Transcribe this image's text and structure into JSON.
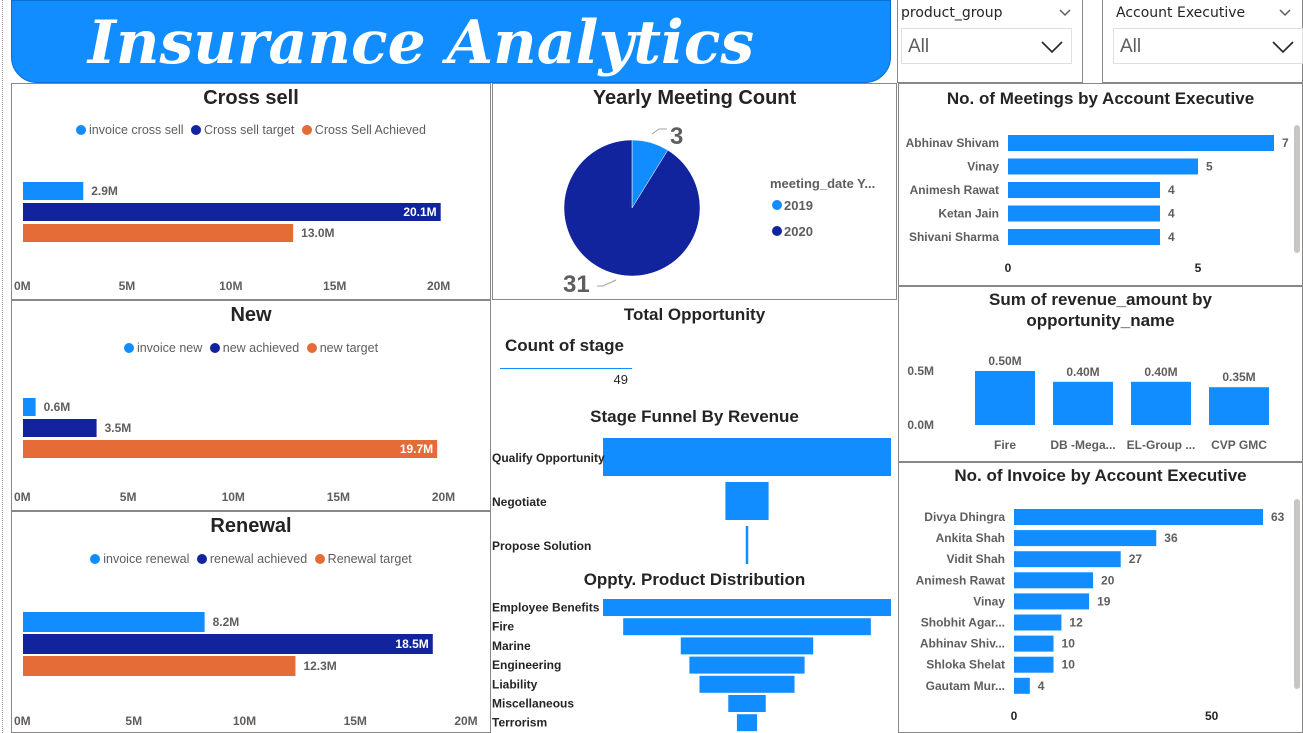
{
  "header": {
    "title": "Insurance Analytics"
  },
  "slicers": [
    {
      "label": "product_group",
      "value": "All"
    },
    {
      "label": "Account Executive",
      "value": "All"
    }
  ],
  "colors": {
    "light": "#118dff",
    "dark": "#12239e",
    "orange": "#e66c37",
    "brand": "#118dff"
  },
  "cross_sell": {
    "title": "Cross sell",
    "legend": [
      {
        "name": "invoice cross sell",
        "color": "#118dff"
      },
      {
        "name": "Cross sell target",
        "color": "#12239e"
      },
      {
        "name": "Cross Sell Achieved",
        "color": "#e66c37"
      }
    ]
  },
  "new": {
    "title": "New",
    "legend": [
      {
        "name": "invoice new",
        "color": "#118dff"
      },
      {
        "name": "new achieved",
        "color": "#12239e"
      },
      {
        "name": "new target",
        "color": "#e66c37"
      }
    ]
  },
  "renewal": {
    "title": "Renewal",
    "legend": [
      {
        "name": "invoice renewal",
        "color": "#118dff"
      },
      {
        "name": "renewal achieved",
        "color": "#12239e"
      },
      {
        "name": "Renewal target",
        "color": "#e66c37"
      }
    ]
  },
  "yearly": {
    "title": "Yearly Meeting Count",
    "legend_title": "meeting_date Y..."
  },
  "total_opp": {
    "title": "Total Opportunity",
    "card_label": "Count of stage",
    "card_value": "49"
  },
  "funnel_stage": {
    "title": "Stage Funnel By Revenue"
  },
  "funnel_product": {
    "title": "Oppty. Product Distribution"
  },
  "meetings": {
    "title": "No. of Meetings by Account Executive"
  },
  "revenue": {
    "title_line1": "Sum of revenue_amount by",
    "title_line2": "opportunity_name"
  },
  "invoice": {
    "title": "No. of Invoice by Account Executive"
  },
  "chart_data": [
    {
      "id": "cross_sell",
      "type": "bar",
      "orientation": "horizontal",
      "series": [
        {
          "name": "invoice cross sell",
          "value": 2.9,
          "label": "2.9M"
        },
        {
          "name": "Cross sell target",
          "value": 20.1,
          "label": "20.1M"
        },
        {
          "name": "Cross Sell Achieved",
          "value": 13.0,
          "label": "13.0M"
        }
      ],
      "xlim": [
        0,
        20.5
      ],
      "ticks": [
        0,
        5,
        10,
        15,
        20
      ],
      "tick_labels": [
        "0M",
        "5M",
        "10M",
        "15M",
        "20M"
      ]
    },
    {
      "id": "new",
      "type": "bar",
      "orientation": "horizontal",
      "series": [
        {
          "name": "invoice new",
          "value": 0.6,
          "label": "0.6M"
        },
        {
          "name": "new achieved",
          "value": 3.5,
          "label": "3.5M"
        },
        {
          "name": "new target",
          "value": 19.7,
          "label": "19.7M"
        }
      ],
      "xlim": [
        0,
        20.5
      ],
      "ticks": [
        0,
        5,
        10,
        15,
        20
      ],
      "tick_labels": [
        "0M",
        "5M",
        "10M",
        "15M",
        "20M"
      ]
    },
    {
      "id": "renewal",
      "type": "bar",
      "orientation": "horizontal",
      "series": [
        {
          "name": "invoice renewal",
          "value": 8.2,
          "label": "8.2M"
        },
        {
          "name": "renewal achieved",
          "value": 18.5,
          "label": "18.5M"
        },
        {
          "name": "Renewal target",
          "value": 12.3,
          "label": "12.3M"
        }
      ],
      "xlim": [
        0,
        20
      ],
      "ticks": [
        0,
        5,
        10,
        15,
        20
      ],
      "tick_labels": [
        "0M",
        "5M",
        "10M",
        "15M",
        "20M"
      ]
    },
    {
      "id": "yearly",
      "type": "pie",
      "slices": [
        {
          "name": "2019",
          "value": 3,
          "label": "3",
          "color": "#118dff"
        },
        {
          "name": "2020",
          "value": 31,
          "label": "31",
          "color": "#12239e"
        }
      ]
    },
    {
      "id": "meetings",
      "type": "bar",
      "orientation": "horizontal",
      "categories": [
        "Abhinav Shivam",
        "Vinay",
        "Animesh Rawat",
        "Ketan Jain",
        "Shivani Sharma"
      ],
      "values": [
        7,
        5,
        4,
        4,
        4
      ],
      "labels": [
        "7",
        "5",
        "4",
        "4",
        "4"
      ],
      "xlim": [
        0,
        7
      ],
      "ticks": [
        0,
        5
      ],
      "tick_labels": [
        "0",
        "5"
      ]
    },
    {
      "id": "revenue",
      "type": "bar",
      "orientation": "vertical",
      "categories": [
        "Fire",
        "DB -Mega...",
        "EL-Group ...",
        "CVP GMC"
      ],
      "values": [
        0.5,
        0.4,
        0.4,
        0.35
      ],
      "labels": [
        "0.50M",
        "0.40M",
        "0.40M",
        "0.35M"
      ],
      "ylim": [
        0,
        0.5
      ],
      "ticks": [
        0,
        0.5
      ],
      "tick_labels": [
        "0.0M",
        "0.5M"
      ]
    },
    {
      "id": "invoice",
      "type": "bar",
      "orientation": "horizontal",
      "categories": [
        "Divya Dhingra",
        "Ankita Shah",
        "Vidit Shah",
        "Animesh Rawat",
        "Vinay",
        "Shobhit Agar...",
        "Abhinav Shiv...",
        "Shloka Shelat",
        "Gautam Mur..."
      ],
      "values": [
        63,
        36,
        27,
        20,
        19,
        12,
        10,
        10,
        4
      ],
      "labels": [
        "63",
        "36",
        "27",
        "20",
        "19",
        "12",
        "10",
        "10",
        "4"
      ],
      "xlim": [
        0,
        63
      ],
      "ticks": [
        0,
        50
      ],
      "tick_labels": [
        "0",
        "50"
      ]
    },
    {
      "id": "funnel_stage",
      "type": "funnel",
      "categories": [
        "Qualify Opportunity",
        "Negotiate",
        "Propose Solution"
      ],
      "values": [
        100,
        15,
        0.8
      ]
    },
    {
      "id": "funnel_product",
      "type": "funnel",
      "categories": [
        "Employee Benefits",
        "Fire",
        "Marine",
        "Engineering",
        "Liability",
        "Miscellaneous",
        "Terrorism"
      ],
      "values": [
        100,
        86,
        46,
        40,
        33,
        13,
        7
      ]
    }
  ]
}
